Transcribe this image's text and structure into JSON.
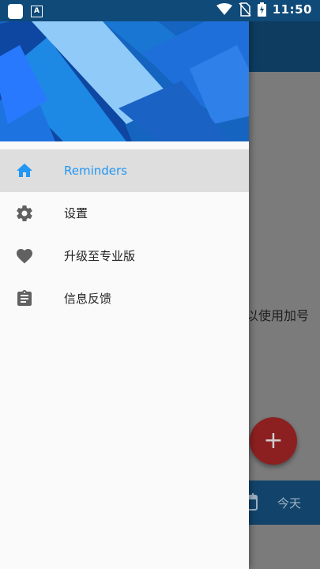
{
  "status_bar": {
    "time": "11:50",
    "icons": [
      "app-notification-icon",
      "font-notification-icon",
      "wifi-icon",
      "no-sim-icon",
      "battery-charging-icon"
    ]
  },
  "background_app": {
    "hint_text": "以使用加号",
    "fab_symbol": "+",
    "today_label": "今天"
  },
  "drawer": {
    "menu": [
      {
        "label": "Reminders",
        "icon": "home-icon",
        "active": true
      },
      {
        "label": "设置",
        "icon": "gear-icon",
        "active": false
      },
      {
        "label": "升级至专业版",
        "icon": "heart-icon",
        "active": false
      },
      {
        "label": "信息反馈",
        "icon": "clipboard-icon",
        "active": false
      }
    ]
  },
  "colors": {
    "accent": "#2196f3",
    "icon_gray": "#616161",
    "fab_red": "#c62828",
    "primary_dark": "#0f4a78"
  }
}
